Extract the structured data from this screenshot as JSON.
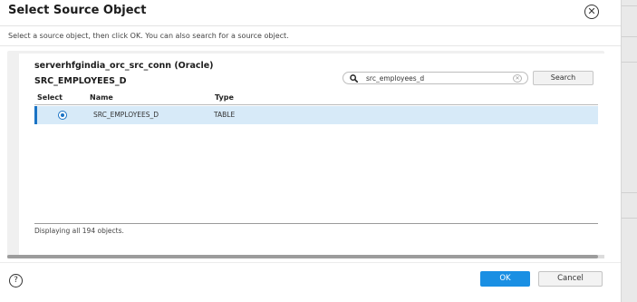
{
  "dialog": {
    "title": "Select Source Object",
    "close_icon": "circle-x-icon",
    "instructions": "Select a source object, then click OK. You can also search for a source object."
  },
  "connection": {
    "name": "serverhfgindia_orc_src_conn (Oracle)",
    "selected_object": "SRC_EMPLOYEES_D"
  },
  "search": {
    "icon": "search-icon",
    "value": "src_employees_d",
    "clear_icon": "clear-icon",
    "button_label": "Search"
  },
  "table": {
    "columns": [
      "Select",
      "Name",
      "Type"
    ],
    "rows": [
      {
        "selected": true,
        "name": "SRC_EMPLOYEES_D",
        "type": "TABLE"
      }
    ]
  },
  "status": "Displaying all 194 objects.",
  "footer": {
    "help_icon": "help-icon",
    "ok_label": "OK",
    "cancel_label": "Cancel"
  },
  "colors": {
    "accent": "#1a8fe3",
    "selected_row": "#d7eaf8",
    "selected_border": "#1a73c4"
  }
}
